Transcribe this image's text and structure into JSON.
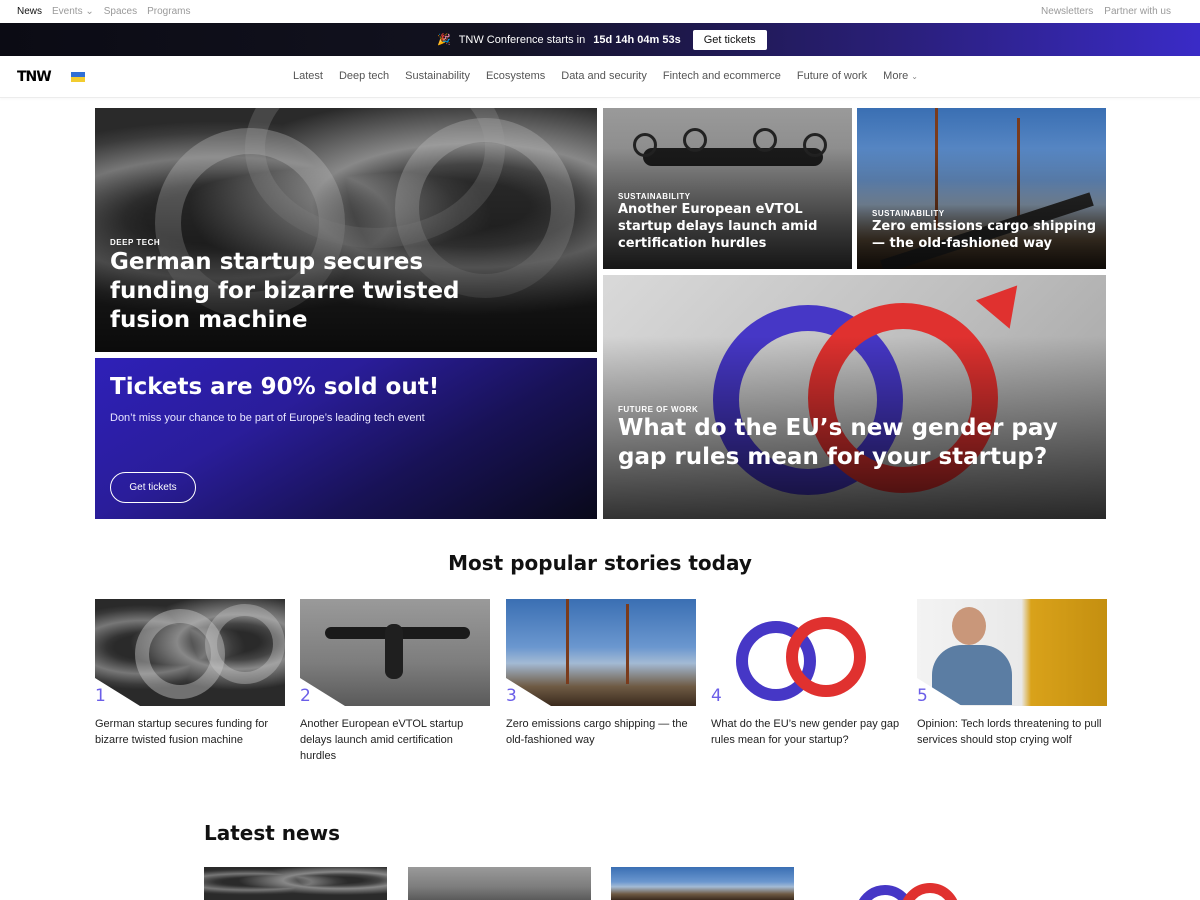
{
  "util": {
    "left": [
      {
        "label": "News",
        "active": true
      },
      {
        "label": "Events ⌄",
        "active": false
      },
      {
        "label": "Spaces",
        "active": false
      },
      {
        "label": "Programs",
        "active": false
      }
    ],
    "right": [
      "Newsletters",
      "Partner with us"
    ]
  },
  "conference": {
    "emoji": "🎉",
    "text": "TNW Conference starts in",
    "countdown": "15d 14h 04m 53s",
    "button": "Get tickets"
  },
  "nav": {
    "logo": "TNW",
    "items": [
      "Latest",
      "Deep tech",
      "Sustainability",
      "Ecosystems",
      "Data and security",
      "Fintech and ecommerce",
      "Future of work"
    ],
    "more": "More"
  },
  "hero": {
    "main": {
      "category": "DEEP TECH",
      "title": "German startup secures funding for bizarre twisted fusion machine"
    },
    "evtol": {
      "category": "SUSTAINABILITY",
      "title": "Another European eVTOL startup delays launch amid certification hurdles"
    },
    "ship": {
      "category": "SUSTAINABILITY",
      "title": "Zero emissions cargo shipping — the old-fashioned way"
    },
    "gender": {
      "category": "FUTURE OF WORK",
      "title": "What do the EU’s new gender pay gap rules mean for your startup?"
    },
    "tickets": {
      "title": "Tickets are 90% sold out!",
      "subtitle": "Don’t miss your chance to be part of Europe’s leading tech event",
      "button": "Get tickets"
    }
  },
  "popular": {
    "heading": "Most popular stories today",
    "items": [
      {
        "num": "1",
        "title": "German startup secures funding for bizarre twisted fusion machine"
      },
      {
        "num": "2",
        "title": "Another European eVTOL startup delays launch amid certification hurdles"
      },
      {
        "num": "3",
        "title": "Zero emissions cargo shipping — the old-fashioned way"
      },
      {
        "num": "4",
        "title": "What do the EU’s new gender pay gap rules mean for your startup?"
      },
      {
        "num": "5",
        "title": "Opinion: Tech lords threatening to pull services should stop crying wolf"
      }
    ]
  },
  "latest": {
    "heading": "Latest news"
  }
}
